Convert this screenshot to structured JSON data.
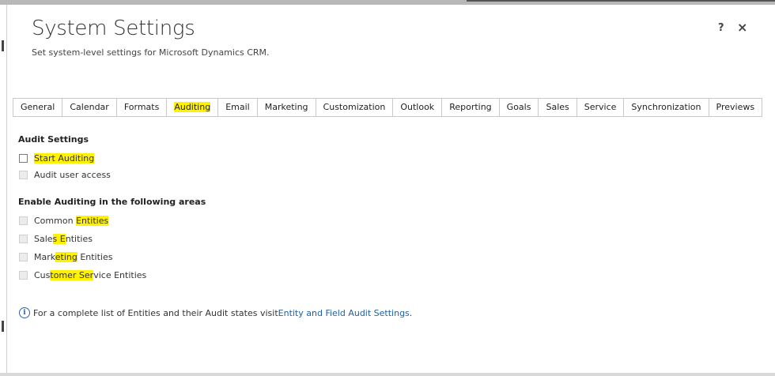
{
  "dialog": {
    "title": "System Settings",
    "subtitle": "Set system-level settings for Microsoft Dynamics CRM.",
    "help_label": "?",
    "close_label": "×"
  },
  "tabs": [
    {
      "label": "General",
      "highlighted": false
    },
    {
      "label": "Calendar",
      "highlighted": false
    },
    {
      "label": "Formats",
      "highlighted": false
    },
    {
      "label": "Auditing",
      "highlighted": true
    },
    {
      "label": "Email",
      "highlighted": false
    },
    {
      "label": "Marketing",
      "highlighted": false
    },
    {
      "label": "Customization",
      "highlighted": false
    },
    {
      "label": "Outlook",
      "highlighted": false
    },
    {
      "label": "Reporting",
      "highlighted": false
    },
    {
      "label": "Goals",
      "highlighted": false
    },
    {
      "label": "Sales",
      "highlighted": false
    },
    {
      "label": "Service",
      "highlighted": false
    },
    {
      "label": "Synchronization",
      "highlighted": false
    },
    {
      "label": "Previews",
      "highlighted": false
    }
  ],
  "audit_settings": {
    "heading": "Audit Settings",
    "start_auditing": {
      "label": "Start Auditing",
      "checked": false,
      "enabled": true
    },
    "audit_user_access": {
      "label": "Audit user access",
      "checked": false,
      "enabled": false
    }
  },
  "areas": {
    "heading": "Enable Auditing in the following areas",
    "items": [
      {
        "pre": "Common ",
        "hl": "Entities",
        "post": "",
        "checked": false,
        "enabled": false
      },
      {
        "pre": "Sale",
        "hl": "s E",
        "post": "ntities",
        "checked": false,
        "enabled": false
      },
      {
        "pre": "Mark",
        "hl": "eting",
        "post": " Entities",
        "checked": false,
        "enabled": false
      },
      {
        "pre": "Cus",
        "hl": "tomer Ser",
        "post": "vice Entities",
        "checked": false,
        "enabled": false
      }
    ]
  },
  "info": {
    "icon": "info-icon",
    "text": "For a complete list of Entities and their Audit states visit ",
    "link_text": "Entity and Field Audit Settings",
    "suffix": "."
  },
  "colors": {
    "highlight": "#fff200",
    "link": "#1f5fa8"
  }
}
